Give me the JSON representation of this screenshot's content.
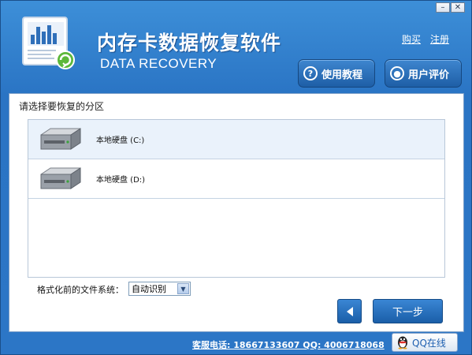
{
  "window": {
    "min_label": "–",
    "close_label": "✕"
  },
  "header": {
    "title_cn": "内存卡数据恢复软件",
    "title_en": "DATA RECOVERY",
    "links": {
      "buy": "购买",
      "register": "注册"
    },
    "tutorial_label": "使用教程",
    "review_label": "用户评价"
  },
  "main": {
    "prompt": "请选择要恢复的分区",
    "partitions": [
      {
        "label": "本地硬盘 (C:)",
        "icon": "hard-drive-icon",
        "selected": true
      },
      {
        "label": "本地硬盘 (D:)",
        "icon": "hard-drive-icon",
        "selected": false
      }
    ],
    "fs_label": "格式化前的文件系统：",
    "fs_value": "自动识别",
    "next_label": "下一步"
  },
  "footer": {
    "service": "客服电话: 18667133607 QQ: 4006718068",
    "qq_label": "QQ在线"
  },
  "colors": {
    "window_blue": "#2a74c4",
    "button_blue": "#1a5ea8",
    "selected_row": "#eaf2fb"
  }
}
